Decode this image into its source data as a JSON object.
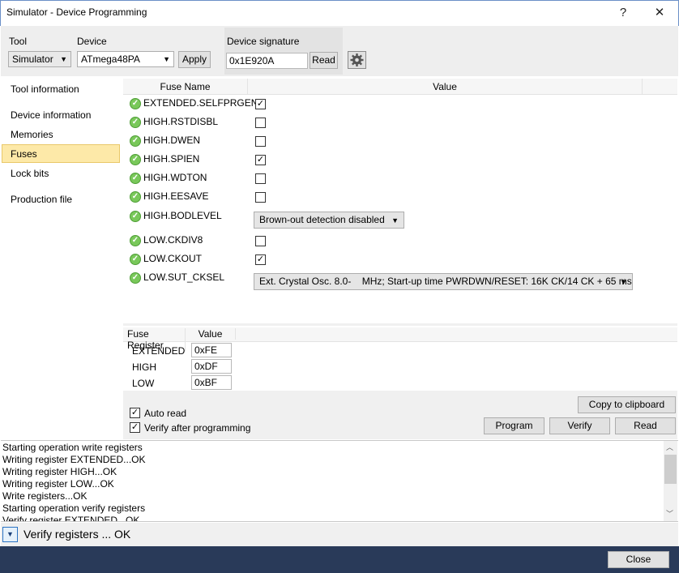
{
  "window": {
    "title": "Simulator - Device Programming",
    "help_glyph": "?",
    "close_glyph": "✕"
  },
  "toolbar": {
    "tool_label": "Tool",
    "tool_value": "Simulator",
    "device_label": "Device",
    "device_value": "ATmega48PA",
    "apply_label": "Apply",
    "signature_label": "Device signature",
    "signature_value": "0x1E920A",
    "read_label": "Read"
  },
  "sidebar": {
    "items": [
      {
        "label": "Tool information"
      },
      {
        "label": "Device information"
      },
      {
        "label": "Memories"
      },
      {
        "label": "Fuses",
        "selected": true
      },
      {
        "label": "Lock bits"
      },
      {
        "label": "Production file"
      }
    ]
  },
  "fuses": {
    "col_name": "Fuse Name",
    "col_value": "Value",
    "rows": [
      {
        "name": "EXTENDED.SELFPRGEN",
        "type": "checkbox",
        "checked": true
      },
      {
        "name": "HIGH.RSTDISBL",
        "type": "checkbox",
        "checked": false
      },
      {
        "name": "HIGH.DWEN",
        "type": "checkbox",
        "checked": false
      },
      {
        "name": "HIGH.SPIEN",
        "type": "checkbox",
        "checked": true
      },
      {
        "name": "HIGH.WDTON",
        "type": "checkbox",
        "checked": false
      },
      {
        "name": "HIGH.EESAVE",
        "type": "checkbox",
        "checked": false
      },
      {
        "name": "HIGH.BODLEVEL",
        "type": "select",
        "value": "Brown-out detection disabled"
      },
      {
        "name": "LOW.CKDIV8",
        "type": "checkbox",
        "checked": false
      },
      {
        "name": "LOW.CKOUT",
        "type": "checkbox",
        "checked": true
      },
      {
        "name": "LOW.SUT_CKSEL",
        "type": "select",
        "value": "Ext. Crystal Osc. 8.0-    MHz; Start-up time PWRDWN/RESET: 16K CK/14 CK + 65 ms"
      }
    ]
  },
  "registers": {
    "col_reg": "Fuse Register",
    "col_value": "Value",
    "rows": [
      {
        "name": "EXTENDED",
        "value": "0xFE"
      },
      {
        "name": "HIGH",
        "value": "0xDF"
      },
      {
        "name": "LOW",
        "value": "0xBF"
      }
    ]
  },
  "options": {
    "auto_read": "Auto read",
    "auto_read_checked": true,
    "verify_after": "Verify after programming",
    "verify_after_checked": true,
    "copy_label": "Copy to clipboard",
    "program_label": "Program",
    "verify_label": "Verify",
    "read_label": "Read"
  },
  "log": {
    "lines": [
      "Starting operation write registers",
      "Writing register EXTENDED...OK",
      "Writing register HIGH...OK",
      "Writing register LOW...OK",
      "Write registers...OK",
      "Starting operation verify registers",
      "Verify register EXTENDED...OK"
    ]
  },
  "status": {
    "text": "Verify registers ... OK"
  },
  "footer": {
    "close_label": "Close"
  },
  "icons": {
    "ok": "check-circle-icon",
    "settings": "gear-icon"
  },
  "colors": {
    "selection": "#fde9a8",
    "ok_green": "#79c85a",
    "footer": "#293a59"
  }
}
